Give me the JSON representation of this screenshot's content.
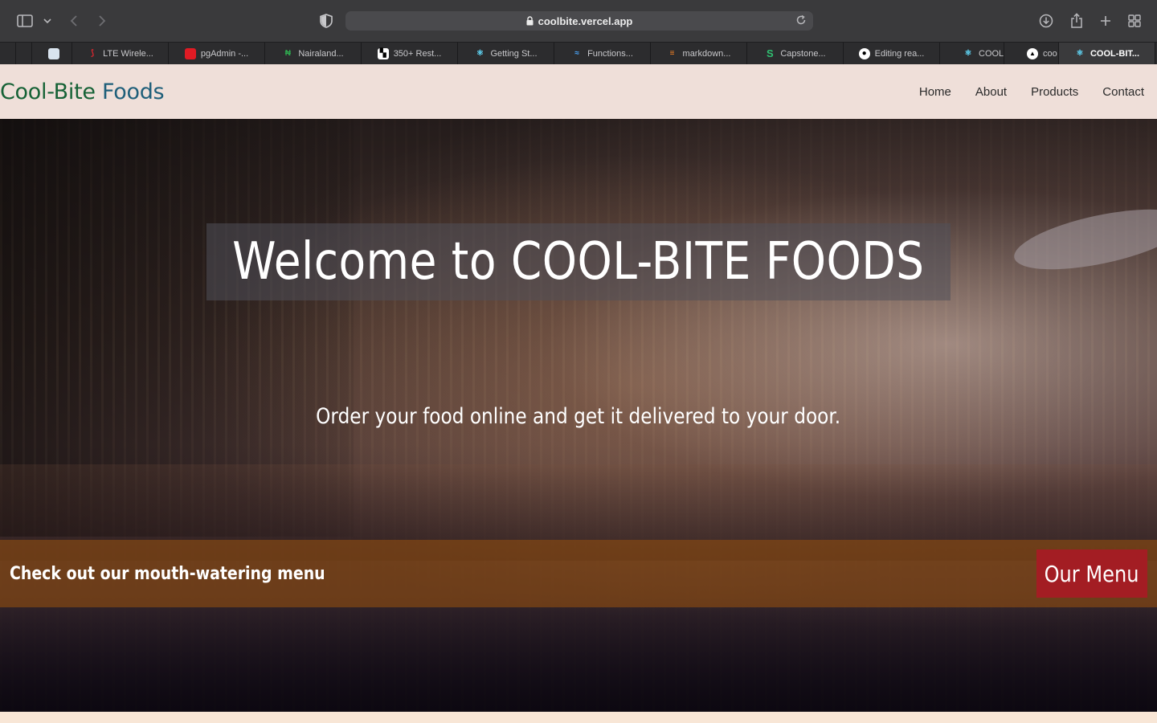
{
  "browser": {
    "url": "coolbite.vercel.app",
    "tabs": [
      {
        "label": "",
        "favicon": "blank"
      },
      {
        "label": "",
        "favicon": "blank"
      },
      {
        "label": "",
        "favicon": "document"
      },
      {
        "label": "LTE Wirele...",
        "favicon": "red-swoosh"
      },
      {
        "label": "pgAdmin -...",
        "favicon": "red-square"
      },
      {
        "label": "Nairaland...",
        "favicon": "green-n"
      },
      {
        "label": "350+ Rest...",
        "favicon": "checker"
      },
      {
        "label": "Getting St...",
        "favicon": "react"
      },
      {
        "label": "Functions...",
        "favicon": "wave"
      },
      {
        "label": "markdown...",
        "favicon": "stack"
      },
      {
        "label": "Capstone...",
        "favicon": "green-s"
      },
      {
        "label": "Editing rea...",
        "favicon": "github"
      },
      {
        "label": "COOL-",
        "favicon": "react"
      },
      {
        "label": "coo",
        "favicon": "vercel"
      },
      {
        "label": "COOL-BIT...",
        "favicon": "react",
        "active": true
      }
    ]
  },
  "site": {
    "brand_part1": "Cool-Bite",
    "brand_part2": " Foods",
    "nav": [
      "Home",
      "About",
      "Products",
      "Contact"
    ],
    "hero_title": "Welcome to COOL-BITE FOODS",
    "hero_subtitle": "Order your food online and get it delivered to your door.",
    "menu_band_text": "Check out our mouth-watering menu",
    "menu_button": "Our Menu"
  },
  "colors": {
    "brand_green": "#166236",
    "brand_blue": "#1f5f7a",
    "header_bg": "#efdfd9",
    "band_bg": "#82461480",
    "button_bg": "#a31d23"
  }
}
